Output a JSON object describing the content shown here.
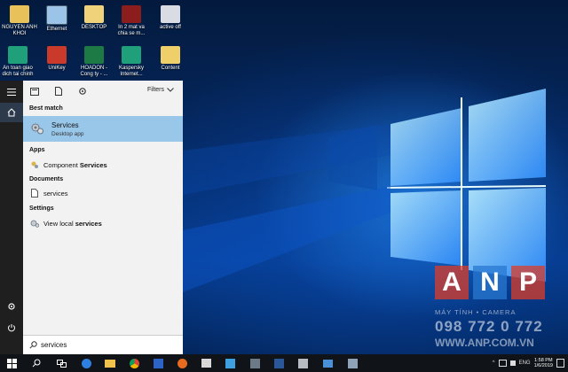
{
  "desktop": {
    "icons": [
      {
        "label": "NGUYEN ANH KHOI",
        "icon": "user-folder-icon"
      },
      {
        "label": "Ethernet",
        "icon": "network-shortcut-icon"
      },
      {
        "label": "DESKTOP",
        "icon": "folder-shortcut-icon"
      },
      {
        "label": "In 2 mat va chia se m...",
        "icon": "document-shortcut-icon"
      },
      {
        "label": "active off",
        "icon": "app-shortcut-icon"
      },
      {
        "label": "An toan giao dich tai chinh",
        "icon": "kaspersky-shield-icon"
      },
      {
        "label": "UniKey",
        "icon": "unikey-icon"
      },
      {
        "label": "HOADON - Cong ty - ...",
        "icon": "excel-file-icon"
      },
      {
        "label": "Kaspersky Internet...",
        "icon": "kaspersky-shield-icon"
      },
      {
        "label": "Content",
        "icon": "folder-icon"
      }
    ]
  },
  "rail": {
    "items": [
      {
        "name": "menu",
        "icon": "hamburger-icon"
      },
      {
        "name": "home",
        "icon": "home-icon"
      },
      {
        "name": "settings",
        "icon": "gear-icon"
      },
      {
        "name": "power",
        "icon": "power-icon"
      }
    ]
  },
  "search_panel": {
    "filter_icons": [
      "apps-filter-icon",
      "documents-filter-icon",
      "settings-filter-icon"
    ],
    "filters_label": "Filters",
    "best_match": {
      "heading": "Best match",
      "title": "Services",
      "subtitle": "Desktop app",
      "icon": "services-gear-icon"
    },
    "apps": {
      "heading": "Apps",
      "items": [
        {
          "prefix": "Component ",
          "match": "Services",
          "icon": "component-services-icon"
        }
      ]
    },
    "documents": {
      "heading": "Documents",
      "items": [
        {
          "label": "services",
          "icon": "document-icon"
        }
      ]
    },
    "settings": {
      "heading": "Settings",
      "items": [
        {
          "prefix": "View local ",
          "match": "services",
          "icon": "services-settings-icon"
        }
      ]
    },
    "search": {
      "value": "services",
      "icon": "search-icon"
    }
  },
  "taskbar": {
    "items": [
      "start-icon",
      "search-icon",
      "task-view-icon",
      "edge-icon",
      "file-explorer-icon",
      "chrome-icon",
      "firefox-icon",
      "store-icon",
      "app-icon",
      "app-icon",
      "word-icon",
      "app-icon",
      "photos-icon",
      "app-icon"
    ],
    "tray_language": "ENG",
    "time": "1:58 PM",
    "date": "1/6/2019"
  },
  "watermark": {
    "letters": [
      "A",
      "N",
      "P"
    ],
    "subtitle": "MÁY TÍNH • CAMERA",
    "phone": "098 772 0 772",
    "url": "WWW.ANP.COM.VN"
  },
  "colors": {
    "best_match_highlight": "#99c7ea",
    "panel_bg": "#f2f2f2",
    "rail_bg": "#1f1f1f",
    "taskbar_bg": "#101418"
  }
}
